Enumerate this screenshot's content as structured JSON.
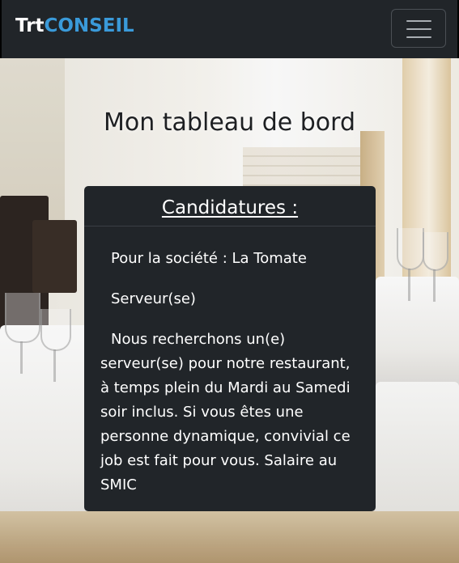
{
  "navbar": {
    "brand_part1": "Trt",
    "brand_part2": "CONSEIL",
    "brand_colors": {
      "part1": "#ffffff",
      "part2": "#3a9ad9"
    },
    "toggler_icon": "hamburger-menu-icon"
  },
  "main": {
    "title": "Mon tableau de bord"
  },
  "card": {
    "header": "Candidatures :",
    "company_line": "Pour la société : La Tomate",
    "job_title": "Serveur(se)",
    "description": "Nous recherchons un(e) serveur(se) pour notre restaurant, à temps plein du Mardi au Samedi soir inclus. Si vous êtes une personne dynamique, convivial ce job est fait pour vous. Salaire au SMIC"
  }
}
